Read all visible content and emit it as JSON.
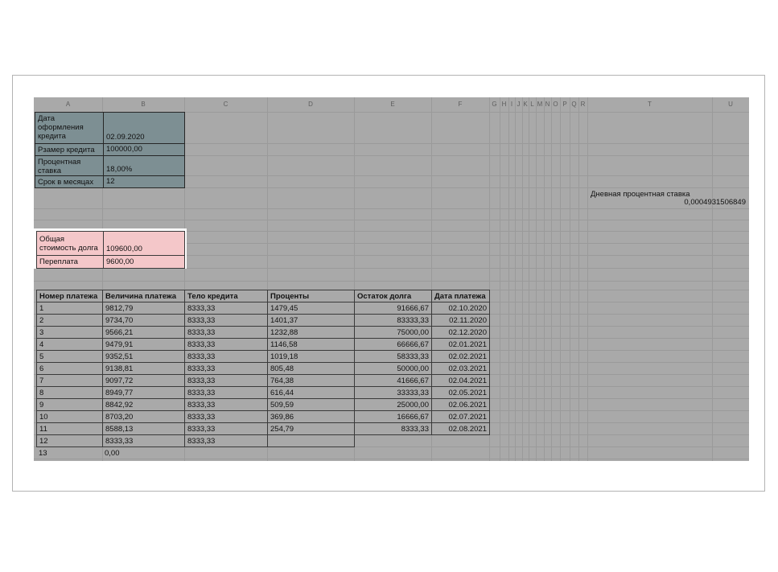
{
  "columns": [
    "A",
    "B",
    "C",
    "D",
    "E",
    "F",
    "G",
    "H",
    "I",
    "J",
    "K",
    "L",
    "M",
    "N",
    "O",
    "P",
    "Q",
    "R",
    "T",
    "U"
  ],
  "params": [
    {
      "label": "Дата оформления кредита",
      "value": "02.09.2020"
    },
    {
      "label": "Рзамер кредита",
      "value": "100000,00"
    },
    {
      "label": "Процентная ставка",
      "value": "18,00%"
    },
    {
      "label": "Срок в месяцах",
      "value": "12"
    }
  ],
  "daily_rate": {
    "label": "Дневная процентная ставка",
    "value": "0,0004931506849"
  },
  "summary": [
    {
      "label": "Общая стоимость долга",
      "value": "109600,00"
    },
    {
      "label": "Переплата",
      "value": "9600,00"
    }
  ],
  "schedule": {
    "headers": [
      "Номер платежа",
      "Величина платежа",
      "Тело кредита",
      "Проценты",
      "Остаток долга",
      "Дата платежа"
    ],
    "rows": [
      [
        "1",
        "9812,79",
        "8333,33",
        "1479,45",
        "91666,67",
        "02.10.2020"
      ],
      [
        "2",
        "9734,70",
        "8333,33",
        "1401,37",
        "83333,33",
        "02.11.2020"
      ],
      [
        "3",
        "9566,21",
        "8333,33",
        "1232,88",
        "75000,00",
        "02.12.2020"
      ],
      [
        "4",
        "9479,91",
        "8333,33",
        "1146,58",
        "66666,67",
        "02.01.2021"
      ],
      [
        "5",
        "9352,51",
        "8333,33",
        "1019,18",
        "58333,33",
        "02.02.2021"
      ],
      [
        "6",
        "9138,81",
        "8333,33",
        "805,48",
        "50000,00",
        "02.03.2021"
      ],
      [
        "7",
        "9097,72",
        "8333,33",
        "764,38",
        "41666,67",
        "02.04.2021"
      ],
      [
        "8",
        "8949,77",
        "8333,33",
        "616,44",
        "33333,33",
        "02.05.2021"
      ],
      [
        "9",
        "8842,92",
        "8333,33",
        "509,59",
        "25000,00",
        "02.06.2021"
      ],
      [
        "10",
        "8703,20",
        "8333,33",
        "369,86",
        "16666,67",
        "02.07.2021"
      ],
      [
        "11",
        "8588,13",
        "8333,33",
        "254,79",
        "8333,33",
        "02.08.2021"
      ],
      [
        "12",
        "8333,33",
        "8333,33",
        "",
        "",
        ""
      ],
      [
        "13",
        "0,00",
        "",
        "",
        "",
        ""
      ]
    ]
  }
}
